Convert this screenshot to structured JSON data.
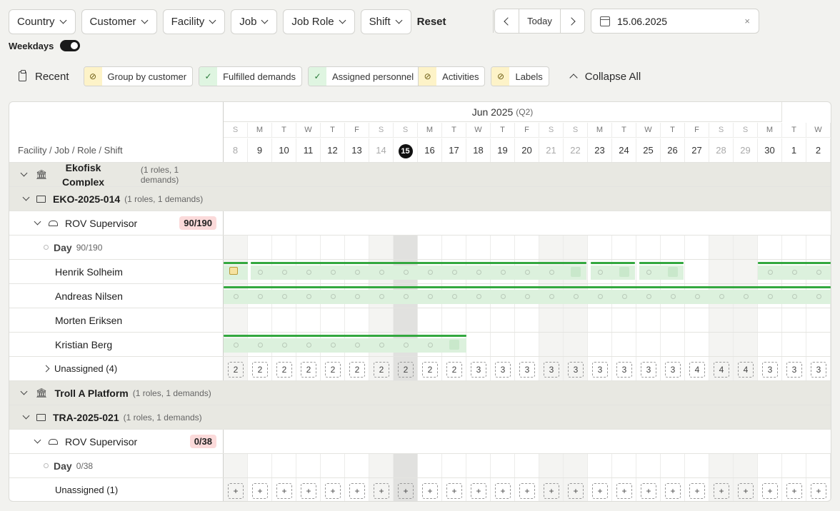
{
  "filters": [
    "Country",
    "Customer",
    "Facility",
    "Job",
    "Job Role",
    "Shift"
  ],
  "reset_label": "Reset",
  "nav": {
    "today_label": "Today"
  },
  "date": {
    "value": "15.06.2025",
    "clear": "×"
  },
  "weekdays": {
    "label": "Weekdays",
    "on": true
  },
  "toolbar": {
    "recent_label": "Recent",
    "chips": [
      {
        "label": "Group by customer",
        "icon": "eye-off-icon",
        "state": "off"
      },
      {
        "label": "Fulfilled demands",
        "icon": "check-icon",
        "state": "on"
      },
      {
        "label": "Assigned personnel",
        "icon": "check-icon",
        "state": "on"
      },
      {
        "label": "Activities",
        "icon": "eye-off-icon",
        "state": "off"
      },
      {
        "label": "Labels",
        "icon": "eye-off-icon",
        "state": "off"
      }
    ],
    "collapse_label": "Collapse All"
  },
  "calendar": {
    "month": "Jun 2025",
    "quarter": "(Q2)",
    "left_header": "Facility / Job / Role / Shift",
    "days": [
      {
        "l": "S",
        "n": "8",
        "we": true
      },
      {
        "l": "M",
        "n": "9"
      },
      {
        "l": "T",
        "n": "10"
      },
      {
        "l": "W",
        "n": "11"
      },
      {
        "l": "T",
        "n": "12"
      },
      {
        "l": "F",
        "n": "13"
      },
      {
        "l": "S",
        "n": "14",
        "we": true
      },
      {
        "l": "S",
        "n": "15",
        "we": true,
        "today": true
      },
      {
        "l": "M",
        "n": "16"
      },
      {
        "l": "T",
        "n": "17"
      },
      {
        "l": "W",
        "n": "18"
      },
      {
        "l": "T",
        "n": "19"
      },
      {
        "l": "F",
        "n": "20"
      },
      {
        "l": "S",
        "n": "21",
        "we": true
      },
      {
        "l": "S",
        "n": "22",
        "we": true
      },
      {
        "l": "M",
        "n": "23"
      },
      {
        "l": "T",
        "n": "24"
      },
      {
        "l": "W",
        "n": "25"
      },
      {
        "l": "T",
        "n": "26"
      },
      {
        "l": "F",
        "n": "27"
      },
      {
        "l": "S",
        "n": "28",
        "we": true
      },
      {
        "l": "S",
        "n": "29",
        "we": true
      },
      {
        "l": "M",
        "n": "30"
      },
      {
        "l": "T",
        "n": "1"
      },
      {
        "l": "W",
        "n": "2"
      }
    ]
  },
  "groups": [
    {
      "facility": "Ekofisk Complex",
      "facility_meta": "(1 roles, 1 demands)",
      "job": "EKO-2025-014",
      "job_meta": "(1 roles, 1 demands)",
      "role": "ROV Supervisor",
      "role_badge": "90/190",
      "shift": "Day",
      "shift_meta": "90/190",
      "personnel": [
        {
          "name": "Henrik Solheim"
        },
        {
          "name": "Andreas Nilsen"
        },
        {
          "name": "Morten Eriksen"
        },
        {
          "name": "Kristian Berg"
        }
      ],
      "unassigned": "Unassigned (4)",
      "unassigned_counts": [
        "2",
        "2",
        "2",
        "2",
        "2",
        "2",
        "2",
        "2",
        "2",
        "2",
        "3",
        "3",
        "3",
        "3",
        "3",
        "3",
        "3",
        "3",
        "3",
        "4",
        "4",
        "4",
        "3",
        "3",
        "3"
      ]
    },
    {
      "facility": "Troll A Platform",
      "facility_meta": "(1 roles, 1 demands)",
      "job": "TRA-2025-021",
      "job_meta": "(1 roles, 1 demands)",
      "role": "ROV Supervisor",
      "role_badge": "0/38",
      "shift": "Day",
      "shift_meta": "0/38",
      "unassigned": "Unassigned (1)",
      "add_symbol": "+"
    }
  ]
}
